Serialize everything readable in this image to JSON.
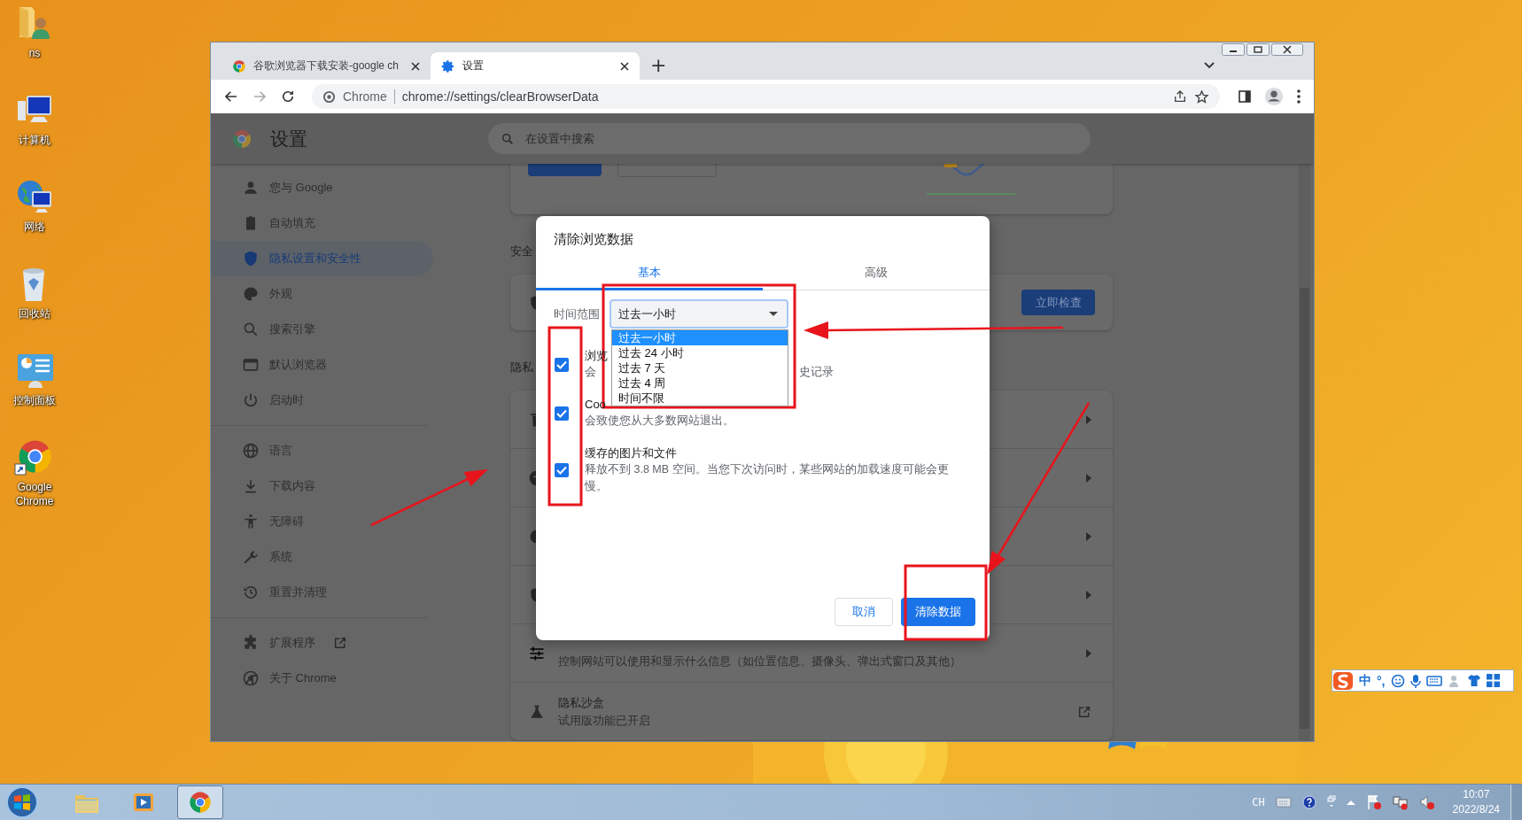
{
  "desktop_icons": [
    {
      "label": "ns"
    },
    {
      "label": "计算机"
    },
    {
      "label": "网络"
    },
    {
      "label": "回收站"
    },
    {
      "label": "控制面板"
    },
    {
      "label": "Google Chrome"
    }
  ],
  "browser": {
    "tabs": [
      {
        "title": "谷歌浏览器下载安装-google ch",
        "selected": false
      },
      {
        "title": "设置",
        "selected": true
      }
    ],
    "new_tab": "+",
    "omnibox": {
      "site": "Chrome",
      "url": "chrome://settings/clearBrowserData"
    }
  },
  "settings": {
    "title": "设置",
    "search": {
      "placeholder": "在设置中搜索"
    },
    "sidebar": [
      {
        "items": [
          {
            "label": "您与 Google",
            "selected": false
          },
          {
            "label": "自动填充",
            "selected": false
          },
          {
            "label": "隐私设置和安全性",
            "selected": true
          },
          {
            "label": "外观",
            "selected": false
          },
          {
            "label": "搜索引擎",
            "selected": false
          },
          {
            "label": "默认浏览器",
            "selected": false
          },
          {
            "label": "启动时",
            "selected": false
          }
        ]
      },
      {
        "items": [
          {
            "label": "语言",
            "selected": false
          },
          {
            "label": "下载内容",
            "selected": false
          },
          {
            "label": "无障碍",
            "selected": false
          },
          {
            "label": "系统",
            "selected": false
          },
          {
            "label": "重置并清理",
            "selected": false
          }
        ]
      },
      {
        "items": [
          {
            "label": "扩展程序",
            "selected": false,
            "external": true
          },
          {
            "label": "关于 Chrome",
            "selected": false,
            "external": false
          }
        ]
      }
    ],
    "safety": {
      "label": "安全",
      "button": "立即检查"
    },
    "privacy": {
      "label": "隐私",
      "rows": [
        {
          "kind": "link"
        },
        {
          "kind": "link"
        },
        {
          "kind": "link"
        },
        {
          "kind": "link"
        },
        {
          "kind": "link",
          "description": "控制网站可以使用和显示什么信息（如位置信息、摄像头、弹出式窗口及其他）"
        },
        {
          "kind": "external",
          "title": "隐私沙盒",
          "description": "试用版功能已开启"
        }
      ]
    }
  },
  "dialog": {
    "title": "清除浏览数据",
    "tabs": [
      {
        "label": "基本",
        "selected": true
      },
      {
        "label": "高级",
        "selected": false
      }
    ],
    "time_range": {
      "label": "时间范围",
      "value": "过去一小时",
      "expanded": true,
      "options": [
        {
          "label": "过去一小时",
          "selected": true
        },
        {
          "label": "过去 24 小时",
          "selected": false
        },
        {
          "label": "过去 7 天",
          "selected": false
        },
        {
          "label": "过去 4 周",
          "selected": false
        },
        {
          "label": "时间不限",
          "selected": false
        }
      ]
    },
    "items": [
      {
        "title": "浏览",
        "description": "会",
        "description_tail": "史记录",
        "checked": true
      },
      {
        "title": "Coo",
        "description": "会致使您从大多数网站退出。",
        "checked": true
      },
      {
        "title": "缓存的图片和文件",
        "description": "释放不到 3.8 MB 空间。当您下次访问时，某些网站的加载速度可能会更慢。",
        "checked": true
      }
    ],
    "buttons": [
      {
        "label": "取消",
        "kind": "secondary"
      },
      {
        "label": "清除数据",
        "kind": "primary"
      }
    ]
  },
  "ime_toolbar": {
    "mode": "中",
    "punctuation": "°,"
  },
  "taskbar": {
    "pinned": [
      {
        "selected": false
      },
      {
        "selected": false
      },
      {
        "selected": true
      }
    ],
    "language": "CH",
    "time": "10:07",
    "date": "2022/8/24"
  }
}
